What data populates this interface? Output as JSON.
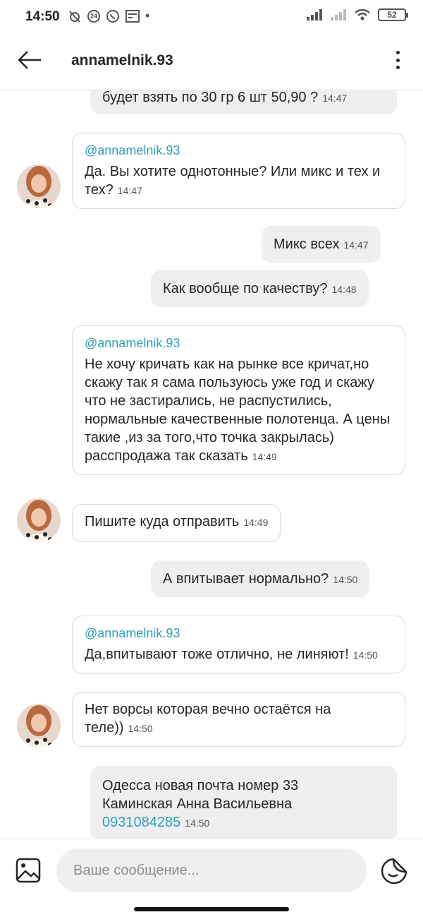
{
  "status_bar": {
    "time": "14:50",
    "badge": "24",
    "battery": "52"
  },
  "header": {
    "title": "annamelnik.93"
  },
  "messages": [
    {
      "text": "будет взять по 30 гр 6 шт 50,90 ?",
      "time": "14:47"
    },
    {
      "mention": "@annamelnik.93",
      "text": "Да. Вы хотите однотонные? Или микс и тех и тех?",
      "time": "14:47"
    },
    {
      "text": "Микс всех",
      "time": "14:47"
    },
    {
      "text": "Как вообще по качеству?",
      "time": "14:48"
    },
    {
      "mention": "@annamelnik.93",
      "text": "Не хочу кричать как на рынке все кричат,но скажу так я сама пользуюсь уже год и скажу что не застирались, не распустились, нормальные качественные полотенца. А цены такие ,из за того,что точка закрылась) расспродажа так сказать",
      "time": "14:49"
    },
    {
      "text": "Пишите куда отправить",
      "time": "14:49"
    },
    {
      "text": "А впитывает нормально?",
      "time": "14:50"
    },
    {
      "mention": "@annamelnik.93",
      "text": "Да,впитывают тоже отлично, не линяют!",
      "time": "14:50"
    },
    {
      "text": "Нет ворсы которая вечно остаётся на теле))",
      "time": "14:50"
    },
    {
      "line1": "Одесса новая почта номер 33",
      "line2": "Каминская Анна Васильевна",
      "phone": "0931084285",
      "time": "14:50"
    }
  ],
  "composer": {
    "placeholder": "Ваше сообщение..."
  },
  "icons": {
    "back": "arrow-left-icon",
    "more": "more-vertical-icon",
    "gallery": "image-icon",
    "sticker": "sticker-icon"
  },
  "colors": {
    "mention": "#2ea0b8",
    "outgoing_bubble": "#efefef",
    "incoming_border": "#dbdbdb"
  }
}
